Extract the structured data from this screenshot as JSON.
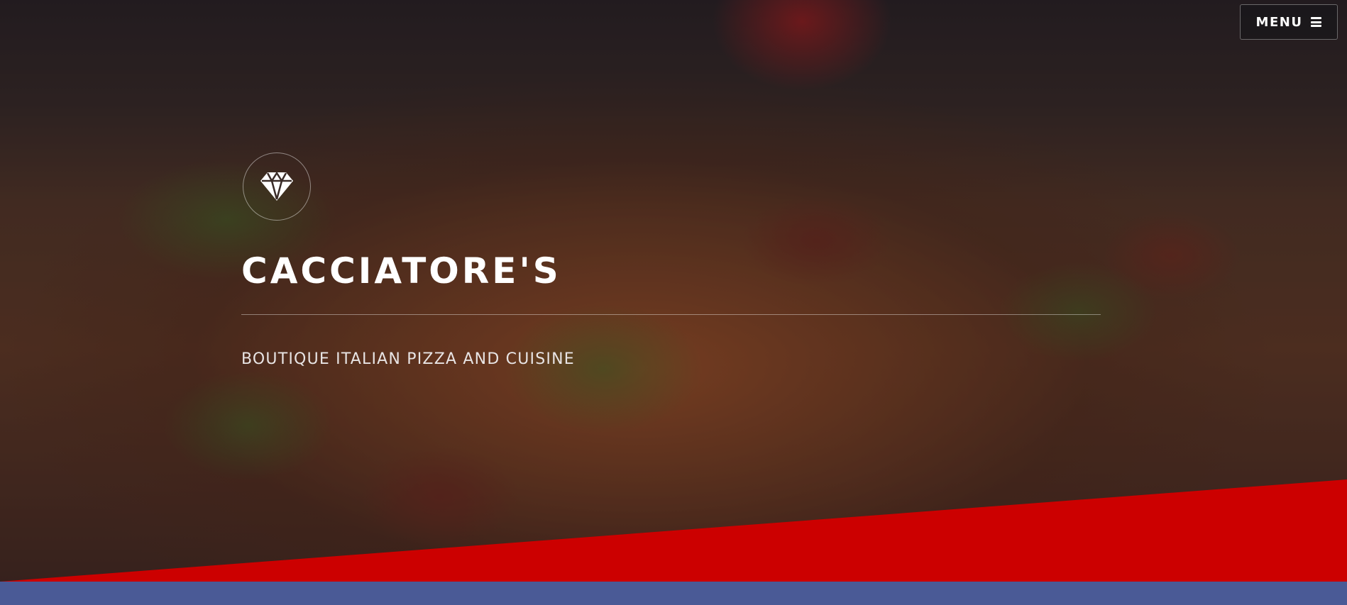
{
  "header": {
    "menu_label": "MENU",
    "menu_icon": "hamburger-icon"
  },
  "hero": {
    "logo_icon": "diamond-icon",
    "title": "CACCIATORE'S",
    "tagline": "BOUTIQUE ITALIAN PIZZA AND CUISINE",
    "background_image": "pizza-photo"
  },
  "colors": {
    "accent_red": "#cc0000",
    "footer_blue": "#4a5a96",
    "text": "#ffffff"
  }
}
